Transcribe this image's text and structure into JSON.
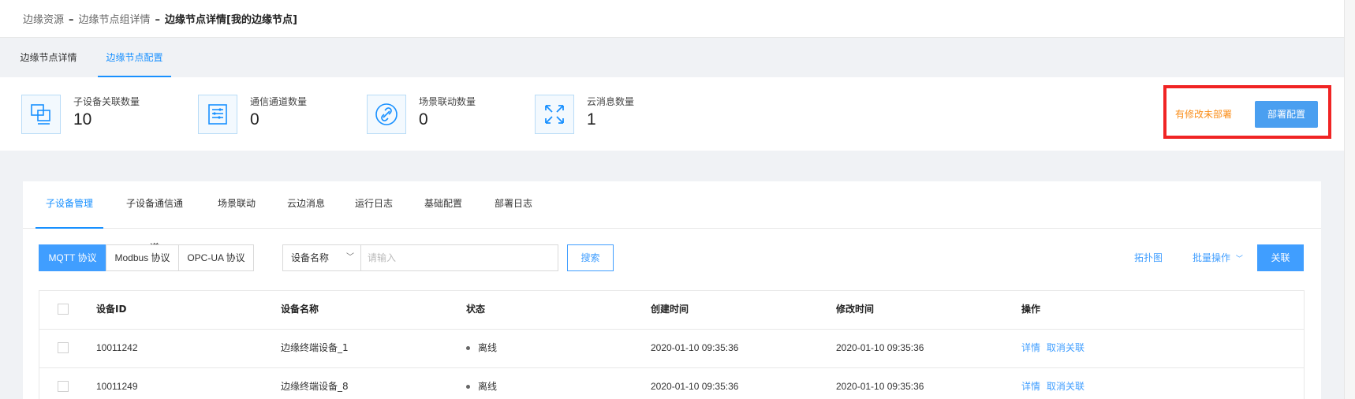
{
  "breadcrumb": {
    "items": [
      "边缘资源",
      "边缘节点组详情"
    ],
    "separator": "–",
    "current": "边缘节点详情[我的边缘节点]"
  },
  "page_tabs": [
    {
      "label": "边缘节点详情",
      "active": false
    },
    {
      "label": "边缘节点配置",
      "active": true
    }
  ],
  "stats": [
    {
      "label": "子设备关联数量",
      "value": "10",
      "icon": "device-link-icon"
    },
    {
      "label": "通信通道数量",
      "value": "0",
      "icon": "channel-list-icon"
    },
    {
      "label": "场景联动数量",
      "value": "0",
      "icon": "link-icon"
    },
    {
      "label": "云消息数量",
      "value": "1",
      "icon": "arrows-icon"
    }
  ],
  "deploy": {
    "status_text": "有修改未部署",
    "button_label": "部署配置"
  },
  "sub_tabs": [
    {
      "label": "子设备管理",
      "active": true
    },
    {
      "label": "子设备通信通道",
      "active": false
    },
    {
      "label": "场景联动",
      "active": false
    },
    {
      "label": "云边消息",
      "active": false
    },
    {
      "label": "运行日志",
      "active": false
    },
    {
      "label": "基础配置",
      "active": false
    },
    {
      "label": "部署日志",
      "active": false
    }
  ],
  "toolbar": {
    "protocols": [
      {
        "label": "MQTT 协议",
        "active": true
      },
      {
        "label": "Modbus 协议",
        "active": false
      },
      {
        "label": "OPC-UA 协议",
        "active": false
      }
    ],
    "select_value": "设备名称",
    "search_placeholder": "请输入",
    "search_label": "搜索",
    "topology_label": "拓扑图",
    "batch_label": "批量操作",
    "associate_label": "关联"
  },
  "table": {
    "columns": [
      "设备ID",
      "设备名称",
      "状态",
      "创建时间",
      "修改时间",
      "操作"
    ],
    "rows": [
      {
        "id": "10011242",
        "name": "边缘终端设备_1",
        "status": "离线",
        "created": "2020-01-10 09:35:36",
        "modified": "2020-01-10 09:35:36",
        "action_detail": "详情",
        "action_unlink": "取消关联"
      },
      {
        "id": "10011249",
        "name": "边缘终端设备_8",
        "status": "离线",
        "created": "2020-01-10 09:35:36",
        "modified": "2020-01-10 09:35:36",
        "action_detail": "详情",
        "action_unlink": "取消关联"
      }
    ]
  },
  "colors": {
    "primary": "#409eff",
    "warning": "#fa8c16",
    "highlight_border": "#f02424"
  }
}
